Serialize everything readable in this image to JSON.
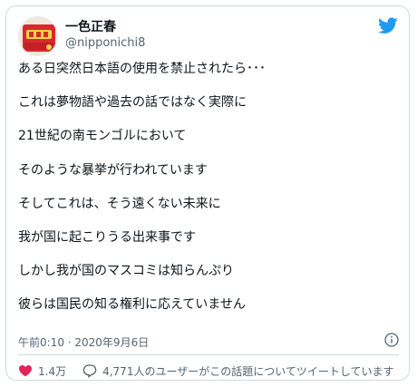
{
  "author": {
    "display_name": "一色正春",
    "handle": "@nipponichi8"
  },
  "tweet": {
    "lines": [
      "ある日突然日本語の使用を禁止されたら･･･",
      "これは夢物語や過去の話ではなく実際に",
      "21世紀の南モンゴルにおいて",
      "そのような暴挙が行われています",
      "そしてこれは、そう遠くない未来に",
      "我が国に起こりうる出来事です",
      "しかし我が国のマスコミは知らんぷり",
      "彼らは国民の知る権利に応えていません"
    ],
    "timestamp": "午前0:10 · 2020年9月6日"
  },
  "actions": {
    "like_count": "1.4万",
    "conversation_text": "4,771人のユーザーがこの話題についてツイートしています"
  },
  "colors": {
    "brand": "#1d9bf0",
    "like": "#e0245e",
    "muted": "#536471"
  }
}
